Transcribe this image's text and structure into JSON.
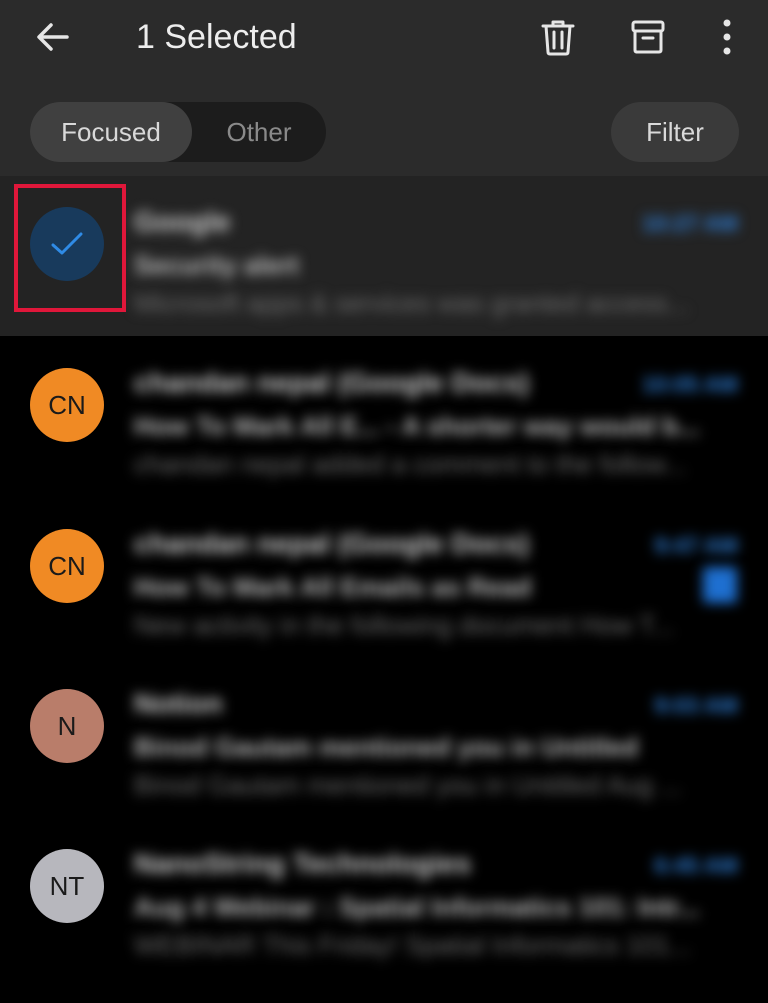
{
  "header": {
    "title": "1 Selected",
    "icons": [
      "back-arrow-icon",
      "trash-icon",
      "archive-icon",
      "more-vertical-icon"
    ]
  },
  "tabs": {
    "focused_label": "Focused",
    "other_label": "Other",
    "active": "Focused",
    "filter_label": "Filter"
  },
  "colors": {
    "topbar": "#2b2b2b",
    "accent": "#2f7fd8",
    "highlight_border": "#e0173a",
    "avatar_orange": "#f08a24",
    "avatar_brown": "#b97d6a",
    "avatar_gray": "#b7b7bd"
  },
  "emails": [
    {
      "selected": true,
      "avatar_initials": "",
      "avatar_icon": "checkmark-icon",
      "sender": "Google",
      "time": "10:27 AM",
      "subject": "Security alert",
      "preview": "Microsoft apps & services was granted access..."
    },
    {
      "selected": false,
      "avatar_initials": "CN",
      "avatar_color": "#f08a24",
      "sender": "chandan nepal (Google Docs)",
      "time": "10:05 AM",
      "subject": "How To Mark All E... - A shorter way would b...",
      "preview": "chandan nepal added a comment to the follow..."
    },
    {
      "selected": false,
      "avatar_initials": "CN",
      "avatar_color": "#f08a24",
      "sender": "chandan nepal (Google Docs)",
      "time": "9:47 AM",
      "subject": "How To Mark All Emails as Read",
      "preview": "New activity in the following document How T...",
      "flagged": true
    },
    {
      "selected": false,
      "avatar_initials": "N",
      "avatar_color": "#b97d6a",
      "sender": "Notion",
      "time": "9:03 AM",
      "subject": "Binod Gautam mentioned you in Untitled",
      "preview": "Binod Gautam mentioned you in Untitled Aug ..."
    },
    {
      "selected": false,
      "avatar_initials": "NT",
      "avatar_color": "#b7b7bd",
      "sender": "NanoString Technologies",
      "time": "6:45 AM",
      "subject": "Aug 4 Webinar : Spatial Informatics 101: Intr...",
      "preview": "WEBINAR This Friday! Spatial Informatics 101..."
    }
  ]
}
